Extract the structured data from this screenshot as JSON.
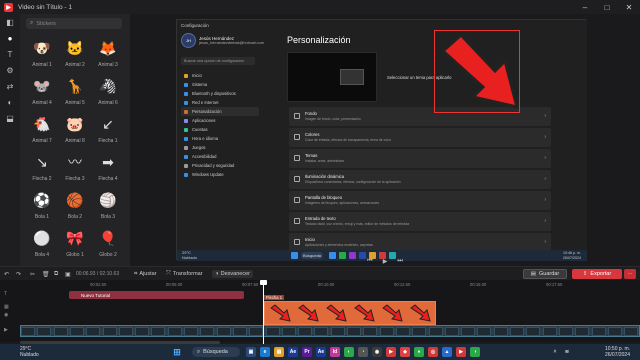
{
  "app": {
    "title": "Video sin Título - 1"
  },
  "window_controls": [
    "–",
    "□",
    "✕"
  ],
  "sidebar_tools": [
    {
      "icon": "collapse-panel-icon"
    },
    {
      "icon": "sticker-icon"
    },
    {
      "icon": "text-icon"
    },
    {
      "icon": "effects-icon"
    },
    {
      "icon": "transitions-icon"
    },
    {
      "icon": "filters-icon"
    },
    {
      "icon": "layers-icon"
    }
  ],
  "panel": {
    "search_placeholder": "Stickers",
    "items": [
      {
        "label": "Animal 1",
        "glyph": "🐶"
      },
      {
        "label": "Animal 2",
        "glyph": "🐱"
      },
      {
        "label": "Animal 3",
        "glyph": "🦊"
      },
      {
        "label": "Animal 4",
        "glyph": "🐭"
      },
      {
        "label": "Animal 5",
        "glyph": "🦒"
      },
      {
        "label": "Animal 6",
        "glyph": "🦓"
      },
      {
        "label": "Animal 7",
        "glyph": "🐔"
      },
      {
        "label": "Animal 8",
        "glyph": "🐷"
      },
      {
        "label": "Flecha 1",
        "glyph": "↙"
      },
      {
        "label": "Flecha 2",
        "glyph": "↘"
      },
      {
        "label": "Flecha 3",
        "glyph": "〰"
      },
      {
        "label": "Flecha 4",
        "glyph": "➡"
      },
      {
        "label": "Bola 1",
        "glyph": "⚽"
      },
      {
        "label": "Bola 2",
        "glyph": "🏀"
      },
      {
        "label": "Bola 3",
        "glyph": "🏐"
      },
      {
        "label": "Bola 4",
        "glyph": "⚪"
      },
      {
        "label": "Globo 1",
        "glyph": "🎀"
      },
      {
        "label": "Globo 2",
        "glyph": "🎈"
      },
      {
        "label": "",
        "glyph": "🍩"
      },
      {
        "label": "",
        "glyph": "🍬"
      },
      {
        "label": "",
        "glyph": "💥"
      }
    ]
  },
  "settings": {
    "window_title": "Configuración",
    "user_name": "Jesús Hernández",
    "user_email": "jesus_hernandezderbak@hotmail.com",
    "search_placeholder": "Buscar una opción de configuración",
    "nav": [
      {
        "label": "Inicio",
        "color": "#e0a030"
      },
      {
        "label": "Sistema",
        "color": "#3a8ee6"
      },
      {
        "label": "Bluetooth y dispositivos",
        "color": "#3a8ee6"
      },
      {
        "label": "Red e Internet",
        "color": "#3a8ee6"
      },
      {
        "label": "Personalización",
        "color": "#d07030"
      },
      {
        "label": "Aplicaciones",
        "color": "#8a8aee"
      },
      {
        "label": "Cuentas",
        "color": "#3ac08a"
      },
      {
        "label": "Hora e idioma",
        "color": "#3a8ee6"
      },
      {
        "label": "Juegos",
        "color": "#9a9a9a"
      },
      {
        "label": "Accesibilidad",
        "color": "#3a8ee6"
      },
      {
        "label": "Privacidad y seguridad",
        "color": "#9a9a9a"
      },
      {
        "label": "Windows Update",
        "color": "#3a8ee6"
      }
    ],
    "heading": "Personalización",
    "theme_label": "Seleccionar un tema para aplicarlo",
    "rows": [
      {
        "title": "Fondo",
        "sub": "Imagen de fondo, color, presentación"
      },
      {
        "title": "Colores",
        "sub": "Color de énfasis, efectos de transparencia, tema de color"
      },
      {
        "title": "Temas",
        "sub": "Instalar, crear, administrar"
      },
      {
        "title": "Iluminación dinámica",
        "sub": "Dispositivos conectados, efectos, configuración de la aplicación"
      },
      {
        "title": "Pantalla de bloqueo",
        "sub": "Imágenes de bloqueo, aplicaciones, animaciones"
      },
      {
        "title": "Entrada de texto",
        "sub": "Teclado táctil, voz a texto, emoji y más, editor de métodos de entrada"
      },
      {
        "title": "Inicio",
        "sub": "Aplicaciones y elementos recientes, carpetas"
      }
    ],
    "inner_taskbar": {
      "weather": "29°C",
      "weather_desc": "Nublado",
      "search": "Búsqueda",
      "time": "10:46 p. m.",
      "date": "26/07/2024"
    }
  },
  "edit_toolbar": {
    "timecode": "00:06.93 / 02:10.63",
    "adjust": "Ajustar",
    "transform": "Transformar",
    "fade": "Desvanecer",
    "save": "Guardar",
    "export": "Exportar"
  },
  "ruler_marks": [
    "00:02.50",
    "00:05.00",
    "00:07.50",
    "00:10.00",
    "00:12.50",
    "00:15.00",
    "00:17.50"
  ],
  "tracks": {
    "text_clip": "Nuevo Tutorial",
    "arrow_clip": "Flecha 1"
  },
  "taskbar": {
    "weather": "29°C",
    "weather_desc": "Nublado",
    "search": "Búsqueda",
    "time": "10:50 p. m.",
    "date": "26/07/2024"
  }
}
